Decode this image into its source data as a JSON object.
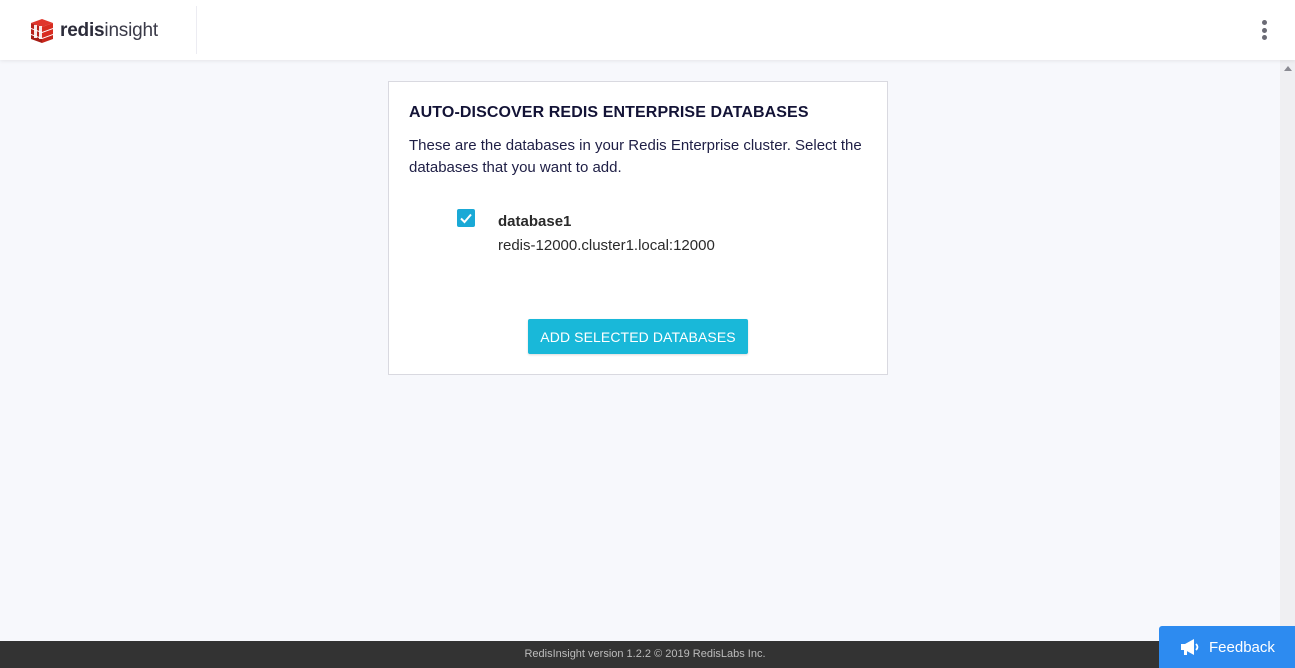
{
  "header": {
    "brand_bold": "redis",
    "brand_light": "insight"
  },
  "card": {
    "title": "AUTO-DISCOVER REDIS ENTERPRISE DATABASES",
    "description": "These are the databases in your Redis Enterprise cluster. Select the databases that you want to add.",
    "databases": [
      {
        "name": "database1",
        "endpoint": "redis-12000.cluster1.local:12000",
        "checked": true
      }
    ],
    "add_button_label": "ADD SELECTED DATABASES"
  },
  "footer": {
    "text": "RedisInsight version 1.2.2 © 2019 RedisLabs Inc."
  },
  "feedback": {
    "label": "Feedback"
  },
  "icons": {
    "logo": "redis-logo-icon",
    "menu": "more-vertical-icon",
    "checkbox": "checkmark-icon",
    "feedback": "megaphone-icon"
  },
  "colors": {
    "accent": "#19b8d9",
    "feedback": "#2d8bf0",
    "brand_red": "#d82c20",
    "footer_bg": "#333333",
    "page_bg": "#f7f8fc"
  }
}
